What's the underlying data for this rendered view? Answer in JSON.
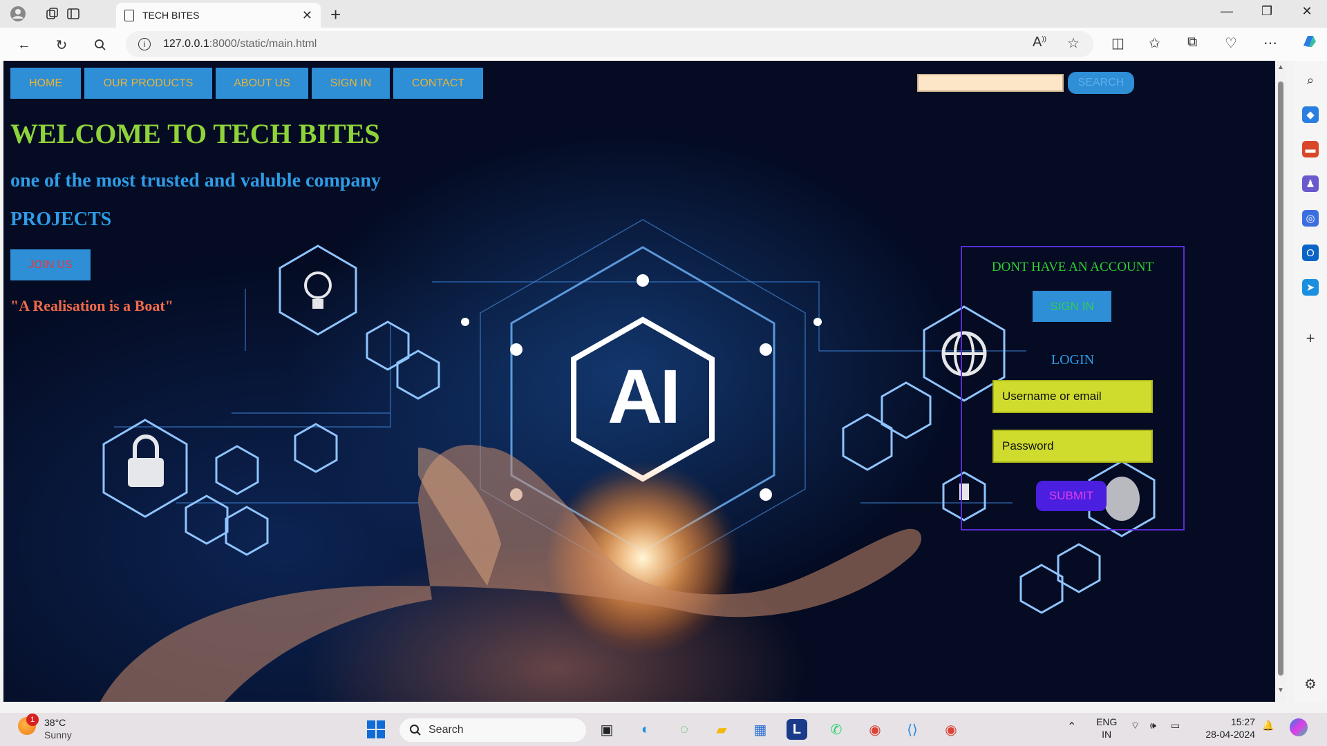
{
  "browser": {
    "tab_title": "TECH BITES",
    "url_host": "127.0.0.1",
    "url_path": ":8000/static/main.html"
  },
  "site": {
    "nav": [
      "HOME",
      "OUR PRODUCTS",
      "ABOUT US",
      "SIGN IN",
      "CONTACT"
    ],
    "search_button": "SEARCH",
    "welcome": "WELCOME TO TECH BITES",
    "subtitle": "one of the most trusted and valuble company",
    "projects": "PROJECTS",
    "join_button": "JOIN US",
    "quote": "\"A Realisation is a Boat\"",
    "background_text": "AI",
    "panel": {
      "title": "DONT HAVE AN ACCOUNT",
      "signin_button": "SIGN IN",
      "login_heading": "LOGIN",
      "username_placeholder": "Username or email",
      "password_placeholder": "Password",
      "submit_button": "SUBMIT"
    },
    "colors": {
      "nav_bg": "#2e8ed6",
      "nav_text": "#e8b437",
      "welcome": "#8fd33a",
      "subtitle": "#2e9ce6",
      "quote": "#f06a4a",
      "panel_border": "#5b2bd8",
      "input_bg": "#cfdc2e",
      "submit_bg": "#4a1fe0"
    }
  },
  "taskbar": {
    "weather_temp": "38°C",
    "weather_desc": "Sunny",
    "weather_badge": "1",
    "search_label": "Search",
    "lang_top": "ENG",
    "lang_bottom": "IN",
    "time": "15:27",
    "date": "28-04-2024"
  }
}
